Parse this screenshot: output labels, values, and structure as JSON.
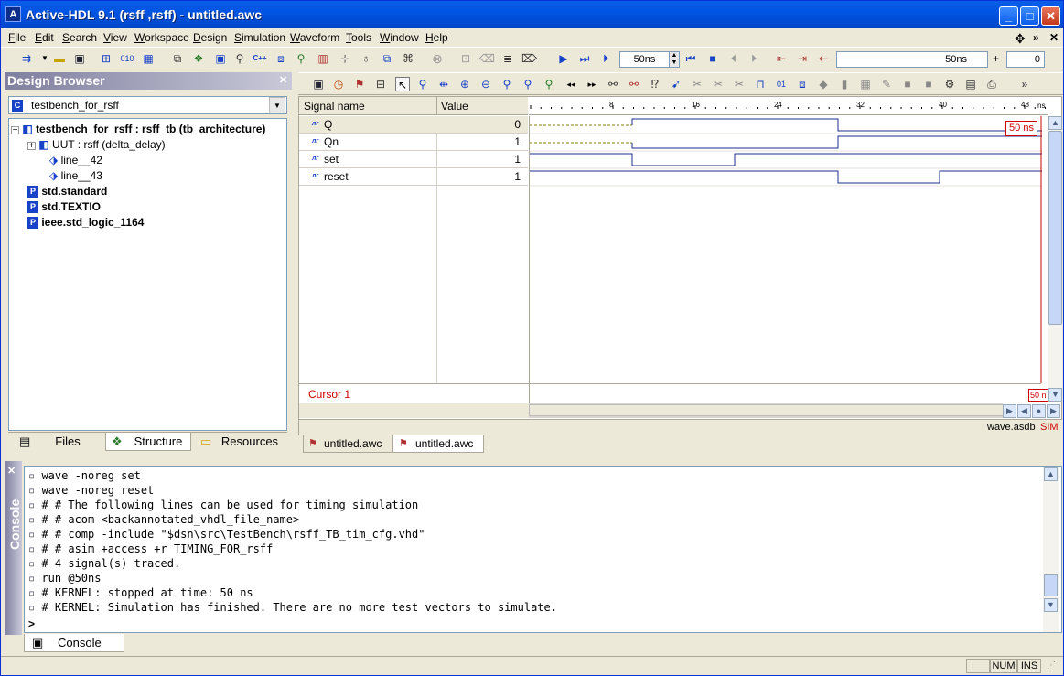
{
  "window": {
    "title": "Active-HDL 9.1 (rsff ,rsff) - untitled.awc",
    "app_icon_label": "A"
  },
  "menubar": {
    "items": [
      "File",
      "Edit",
      "Search",
      "View",
      "Workspace",
      "Design",
      "Simulation",
      "Waveform",
      "Tools",
      "Window",
      "Help"
    ]
  },
  "toolbar": {
    "sim_time_field": "50ns",
    "step_time_field": "50ns",
    "counter_field": "0",
    "plus_label": "+"
  },
  "design_browser": {
    "title": "Design Browser",
    "selected_unit": "testbench_for_rsff",
    "tree": [
      {
        "label": "testbench_for_rsff : rsff_tb (tb_architecture)",
        "bold": true
      },
      {
        "label": "UUT : rsff (delta_delay)",
        "bold": false
      },
      {
        "label": "line__42",
        "bold": false
      },
      {
        "label": "line__43",
        "bold": false
      },
      {
        "label": "std.standard",
        "bold": true
      },
      {
        "label": "std.TEXTIO",
        "bold": true
      },
      {
        "label": "ieee.std_logic_1164",
        "bold": true
      }
    ],
    "tabs": [
      "Files",
      "Structure",
      "Resources"
    ]
  },
  "waveform": {
    "header_signal": "Signal name",
    "header_value": "Value",
    "timeline_unit": "ns",
    "ticks": [
      "8",
      "16",
      "24",
      "32",
      "40",
      "48"
    ],
    "signals": [
      {
        "name": "Q",
        "value": "0"
      },
      {
        "name": "Qn",
        "value": "1"
      },
      {
        "name": "set",
        "value": "1"
      },
      {
        "name": "reset",
        "value": "1"
      }
    ],
    "cursor_label": "Cursor 1",
    "cursor_time": "50 ns",
    "cursor_time_bottom": "50 n",
    "status_file": "wave.asdb",
    "status_mode": "SIM",
    "doc_tabs": [
      "untitled.awc",
      "untitled.awc"
    ],
    "colors": {
      "trace": "#1c2b8f",
      "cursor": "#d00000",
      "undefined": "#808000"
    }
  },
  "console": {
    "title": "Console",
    "lines": [
      "wave -noreg set",
      "wave -noreg reset",
      "# # The following lines can be used for timing simulation",
      "# # acom <backannotated_vhdl_file_name>",
      "# # comp -include \"$dsn\\src\\TestBench\\rsff_TB_tim_cfg.vhd\"",
      "# # asim +access +r TIMING_FOR_rsff",
      "# 4 signal(s) traced.",
      "run @50ns",
      "# KERNEL: stopped at time: 50 ns",
      "# KERNEL: Simulation has finished. There are no more test vectors to simulate."
    ],
    "prompt": ">",
    "tab_label": "Console"
  },
  "statusbar": {
    "num": "NUM",
    "ins": "INS"
  }
}
